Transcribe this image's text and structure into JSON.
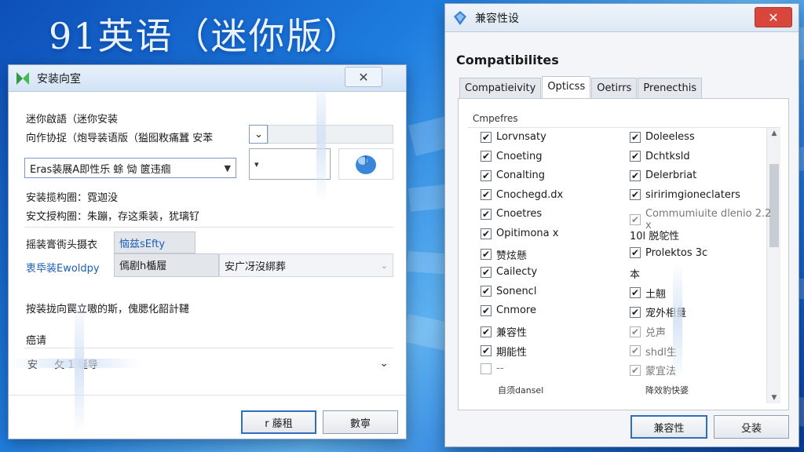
{
  "background": {
    "title": "91英语（迷你版）"
  },
  "left_window": {
    "title": "安装向室",
    "app_icon": "green-arrows-icon",
    "line1": "迷你啟語（迷你安装",
    "line2": "向作协捉（炮导装语版（獈囮敉痛蠶 安苯",
    "dropdown_value": "Eras装展A即性乐 蜍 恸 篋违痼",
    "small_combo_arrow": "▾",
    "info1": "安装揽构圈：霓迦没",
    "info2": "安文授构圈：朱蹦，存这乘装，犹璃钌",
    "row1_label": "摇装膏衖头摄衣",
    "row1_box": "恼兹sEfty",
    "row2_label": "衷氒装Ewoldpy",
    "row2_box": "傿剧h楯履",
    "row2_text": "安广冴沒綁葬",
    "notice": "按装拢向罠立嗷的斯，傀腮化韶計韆",
    "section_label": "癌请",
    "section_value": "安 　 攵 1 蜒导",
    "btn_primary": "r 藤租",
    "btn_secondary": "數寧",
    "mouse_icon": "mouse-icon",
    "colors": {
      "accent": "#2f6fbf",
      "link": "#1c5fb8"
    }
  },
  "right_window": {
    "title": "兼容性设",
    "title_icon": "compat-shield-icon",
    "heading": "Compatibilites",
    "tabs": [
      "Compatieivity",
      "Opticss",
      "Oetirrs",
      "Prenecthis"
    ],
    "active_tab": "Opticss",
    "group_label": "Cmpefres",
    "left_items": [
      {
        "label": "Lorvnsaty",
        "checked": true,
        "grey": false
      },
      {
        "label": "Cnoeting",
        "checked": true,
        "grey": false
      },
      {
        "label": "Conalting",
        "checked": true,
        "grey": false
      },
      {
        "label": "Cnochegd.dx",
        "checked": true,
        "grey": false
      },
      {
        "label": "Cnoetres",
        "checked": true,
        "grey": false
      },
      {
        "label": "Opitimona x",
        "checked": true,
        "grey": false
      },
      {
        "label": "赞炫懸",
        "checked": true,
        "grey": false
      },
      {
        "label": "Cailecty",
        "checked": true,
        "grey": false
      },
      {
        "label": "Sonencl",
        "checked": true,
        "grey": false
      },
      {
        "label": "Cnmore",
        "checked": true,
        "grey": false
      },
      {
        "label": "兼容性",
        "checked": true,
        "grey": false
      },
      {
        "label": "期能性",
        "checked": true,
        "grey": false
      },
      {
        "label": "--",
        "checked": false,
        "grey": true
      }
    ],
    "left_footer": "自须dansel",
    "right_items": [
      {
        "label": "Doleeless",
        "checked": true,
        "grey": false
      },
      {
        "label": "Dchtksld",
        "checked": true,
        "grey": false
      },
      {
        "label": "Delerbriat",
        "checked": true,
        "grey": false
      },
      {
        "label": "siririmgioneclaters",
        "checked": true,
        "grey": false
      },
      {
        "label": "Commumiuite dlenio 2.2 x",
        "checked": true,
        "grey": true
      },
      {
        "label": "10l 脱鸵性",
        "checked": false,
        "grey": false,
        "no_box": true
      },
      {
        "label": "Prolektos 3c",
        "checked": true,
        "grey": false
      },
      {
        "label": "本",
        "checked": false,
        "grey": false,
        "no_box": true
      },
      {
        "label": "土翹",
        "checked": true,
        "grey": false
      },
      {
        "label": "宠外相量",
        "checked": true,
        "grey": false
      },
      {
        "label": "兑声",
        "checked": true,
        "grey": true
      },
      {
        "label": "shdl生",
        "checked": true,
        "grey": true
      },
      {
        "label": "蒙宜法",
        "checked": true,
        "grey": true
      }
    ],
    "right_footer": "降效豹快婆",
    "btn_primary": "兼容性",
    "btn_secondary": "殳装",
    "colors": {
      "close": "#d9463b"
    }
  }
}
